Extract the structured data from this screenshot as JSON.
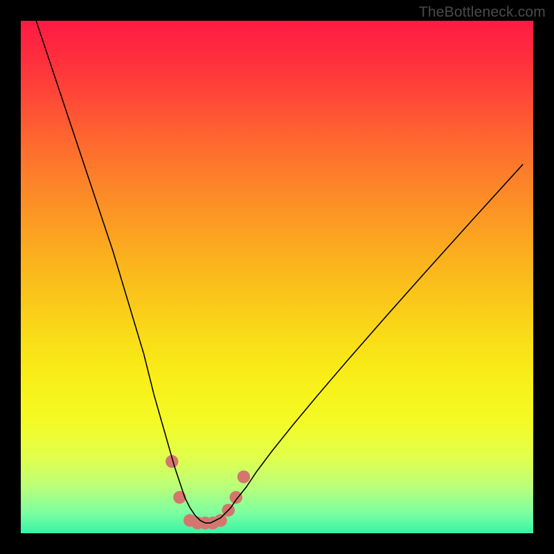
{
  "watermark": "TheBottleneck.com",
  "chart_data": {
    "type": "line",
    "title": "",
    "xlabel": "",
    "ylabel": "",
    "xlim": [
      0,
      100
    ],
    "ylim": [
      0,
      100
    ],
    "grid": false,
    "legend": false,
    "background_gradient": {
      "orientation": "vertical",
      "stops": [
        {
          "pct": 0,
          "color": "#ff1a44"
        },
        {
          "pct": 25,
          "color": "#fd7e2a"
        },
        {
          "pct": 55,
          "color": "#fac61a"
        },
        {
          "pct": 78,
          "color": "#f4fa25"
        },
        {
          "pct": 100,
          "color": "#38f3a6"
        }
      ]
    },
    "series": [
      {
        "name": "bottleneck-curve",
        "stroke": "#000000",
        "stroke_width": 1.5,
        "x": [
          3,
          6,
          9,
          12,
          15,
          18,
          21,
          24,
          26,
          28,
          30,
          31,
          32,
          33,
          34,
          35,
          36,
          37,
          38,
          39,
          40,
          41,
          42,
          44,
          46,
          49,
          53,
          58,
          64,
          71,
          79,
          88,
          98
        ],
        "y": [
          100,
          91,
          82,
          73,
          64,
          55,
          45,
          35,
          27,
          20,
          13,
          10,
          7,
          5,
          3.5,
          2.5,
          2,
          2,
          2.5,
          3,
          4,
          5,
          6.5,
          9,
          12,
          16,
          21,
          27,
          34,
          42,
          51,
          61,
          72
        ]
      },
      {
        "name": "highlight-points",
        "type": "scatter",
        "color": "#d5766e",
        "radius": 9,
        "x": [
          29.5,
          31,
          33,
          34.5,
          36,
          37.5,
          39,
          40.5,
          42,
          43.5
        ],
        "y": [
          14,
          7,
          2.5,
          2,
          2,
          2,
          2.5,
          4.5,
          7,
          11
        ]
      }
    ]
  }
}
